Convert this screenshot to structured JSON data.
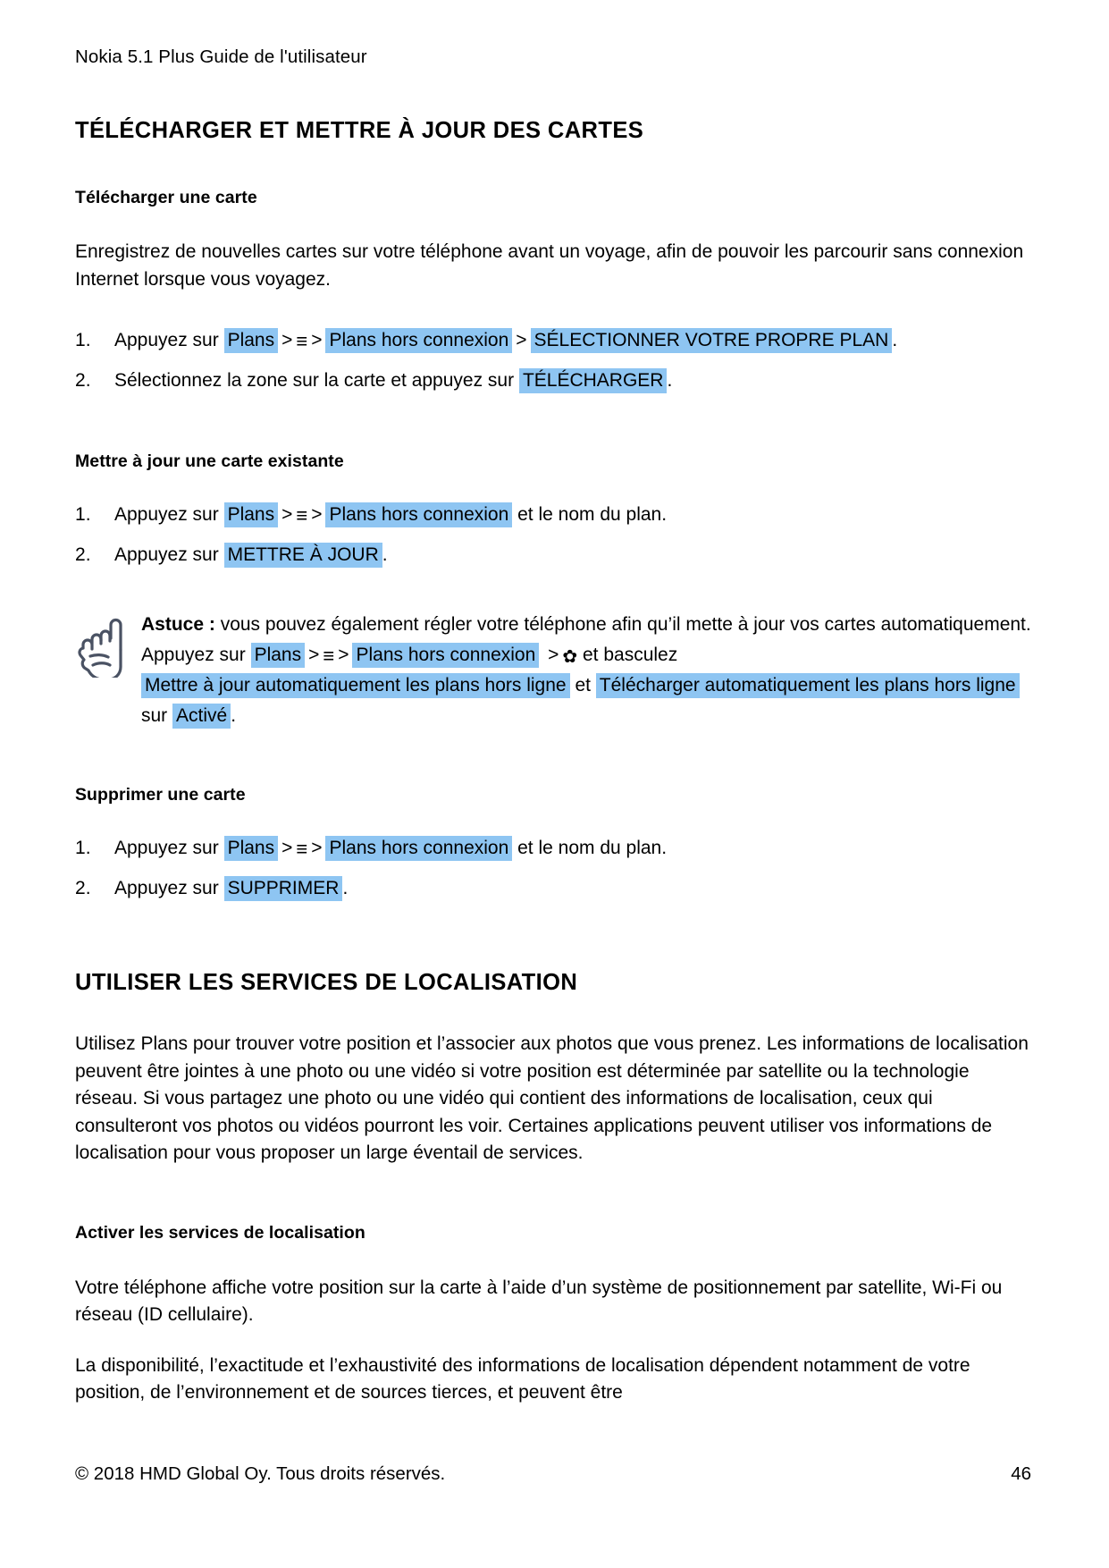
{
  "document": {
    "running_header": "Nokia 5.1 Plus Guide de l'utilisateur",
    "footer_copyright": "© 2018 HMD Global Oy. Tous droits réservés.",
    "page_number": "46"
  },
  "colors": {
    "highlight": "#8ec5f2",
    "text": "#000000",
    "icon": "#4a5263"
  },
  "sections": {
    "maps": {
      "title": "TÉLÉCHARGER ET METTRE À JOUR DES CARTES",
      "download": {
        "subtitle": "Télécharger une carte",
        "intro": "Enregistrez de nouvelles cartes sur votre téléphone avant un voyage, afin de pouvoir les parcourir sans connexion Internet lorsque vous voyagez.",
        "step1": {
          "lead": "Appuyez sur",
          "chip1": "Plans",
          "sep1": ">",
          "menu_icon": "≡",
          "sep2": ">",
          "chip2": "Plans hors connexion",
          "sep3": ">",
          "chip3": "SÉLECTIONNER VOTRE PROPRE PLAN",
          "tail": "."
        },
        "step2": {
          "lead": "Sélectionnez la zone sur la carte et appuyez sur",
          "chip1": "TÉLÉCHARGER",
          "tail": "."
        }
      },
      "update": {
        "subtitle": "Mettre à jour une carte existante",
        "step1": {
          "lead": "Appuyez sur",
          "chip1": "Plans",
          "sep1": ">",
          "menu_icon": "≡",
          "sep2": ">",
          "chip2": "Plans hors connexion",
          "tail": "et le nom du plan."
        },
        "step2": {
          "lead": "Appuyez sur",
          "chip1": "METTRE À JOUR",
          "tail": "."
        },
        "tip": {
          "label": "Astuce :",
          "text1": "vous pouvez également régler votre téléphone afin qu’il mette à jour vos cartes automatiquement. Appuyez sur",
          "chip1": "Plans",
          "sep1": ">",
          "menu_icon": "≡",
          "sep2": ">",
          "chip2": "Plans hors connexion",
          "sep3": ">",
          "gear_icon": "✿",
          "text2": "et basculez",
          "chip3": "Mettre à jour automatiquement les plans hors ligne",
          "text3": "et",
          "chip4": "Télécharger automatiquement les plans hors ligne",
          "text4": "sur",
          "chip5": "Activé",
          "tail": "."
        }
      },
      "delete": {
        "subtitle": "Supprimer une carte",
        "step1": {
          "lead": "Appuyez sur",
          "chip1": "Plans",
          "sep1": ">",
          "menu_icon": "≡",
          "sep2": ">",
          "chip2": "Plans hors connexion",
          "tail": "et le nom du plan."
        },
        "step2": {
          "lead": "Appuyez sur",
          "chip1": "SUPPRIMER",
          "tail": "."
        }
      }
    },
    "location": {
      "title": "UTILISER LES SERVICES DE LOCALISATION",
      "intro": "Utilisez Plans pour trouver votre position et l’associer aux photos que vous prenez. Les informations de localisation peuvent être jointes à une photo ou une vidéo si votre position est déterminée par satellite ou la technologie réseau. Si vous partagez une photo ou une vidéo qui contient des informations de localisation, ceux qui consulteront vos photos ou vidéos pourront les voir. Certaines applications peuvent utiliser vos informations de localisation pour vous proposer un large éventail de services.",
      "activate": {
        "subtitle": "Activer les services de localisation",
        "para1": "Votre téléphone affiche votre position sur la carte à l’aide d’un système de positionnement par satellite, Wi-Fi ou réseau (ID cellulaire).",
        "para2": "La disponibilité, l’exactitude et l’exhaustivité des informations de localisation dépendent notamment de votre position, de l’environnement et de sources tierces, et peuvent être"
      }
    }
  }
}
